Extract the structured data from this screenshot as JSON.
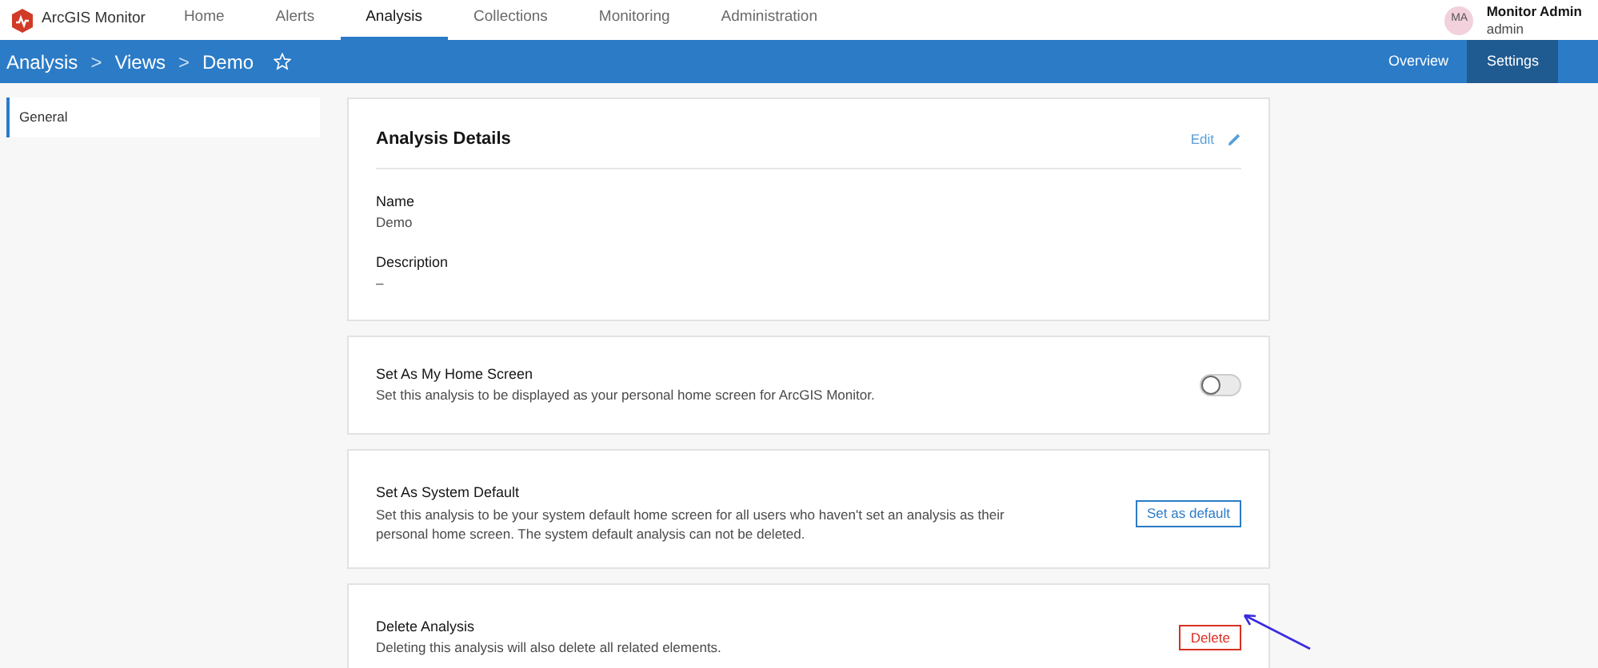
{
  "app": {
    "name": "ArcGIS Monitor"
  },
  "nav": [
    {
      "label": "Home",
      "selected": false
    },
    {
      "label": "Alerts",
      "selected": false
    },
    {
      "label": "Analysis",
      "selected": true
    },
    {
      "label": "Collections",
      "selected": false
    },
    {
      "label": "Monitoring",
      "selected": false
    },
    {
      "label": "Administration",
      "selected": false
    }
  ],
  "user": {
    "initials": "MA",
    "name": "Monitor Admin",
    "role": "admin"
  },
  "breadcrumb": {
    "items": [
      "Analysis",
      "Views",
      "Demo"
    ],
    "separator": ">",
    "favorite": false
  },
  "subtabs": [
    {
      "label": "Overview",
      "selected": false
    },
    {
      "label": "Settings",
      "selected": true
    }
  ],
  "sidebar": {
    "items": [
      {
        "label": "General",
        "selected": true
      }
    ]
  },
  "details": {
    "title": "Analysis Details",
    "edit": "Edit",
    "fields": [
      {
        "label": "Name",
        "value": "Demo"
      },
      {
        "label": "Description",
        "value": "–"
      }
    ]
  },
  "sections": [
    {
      "kind": "toggle",
      "title": "Set As My Home Screen",
      "text": "Set this analysis to be displayed as your personal home screen for ArcGIS Monitor.",
      "on": false
    },
    {
      "kind": "button",
      "title": "Set As System Default",
      "text": "Set this analysis to be your system default home screen for all users who haven't set an analysis as their personal home screen. The system default analysis can not be deleted.",
      "button": "Set as default"
    },
    {
      "kind": "danger",
      "title": "Delete Analysis",
      "text": "Deleting this analysis will also delete all related elements.",
      "button": "Delete"
    }
  ]
}
